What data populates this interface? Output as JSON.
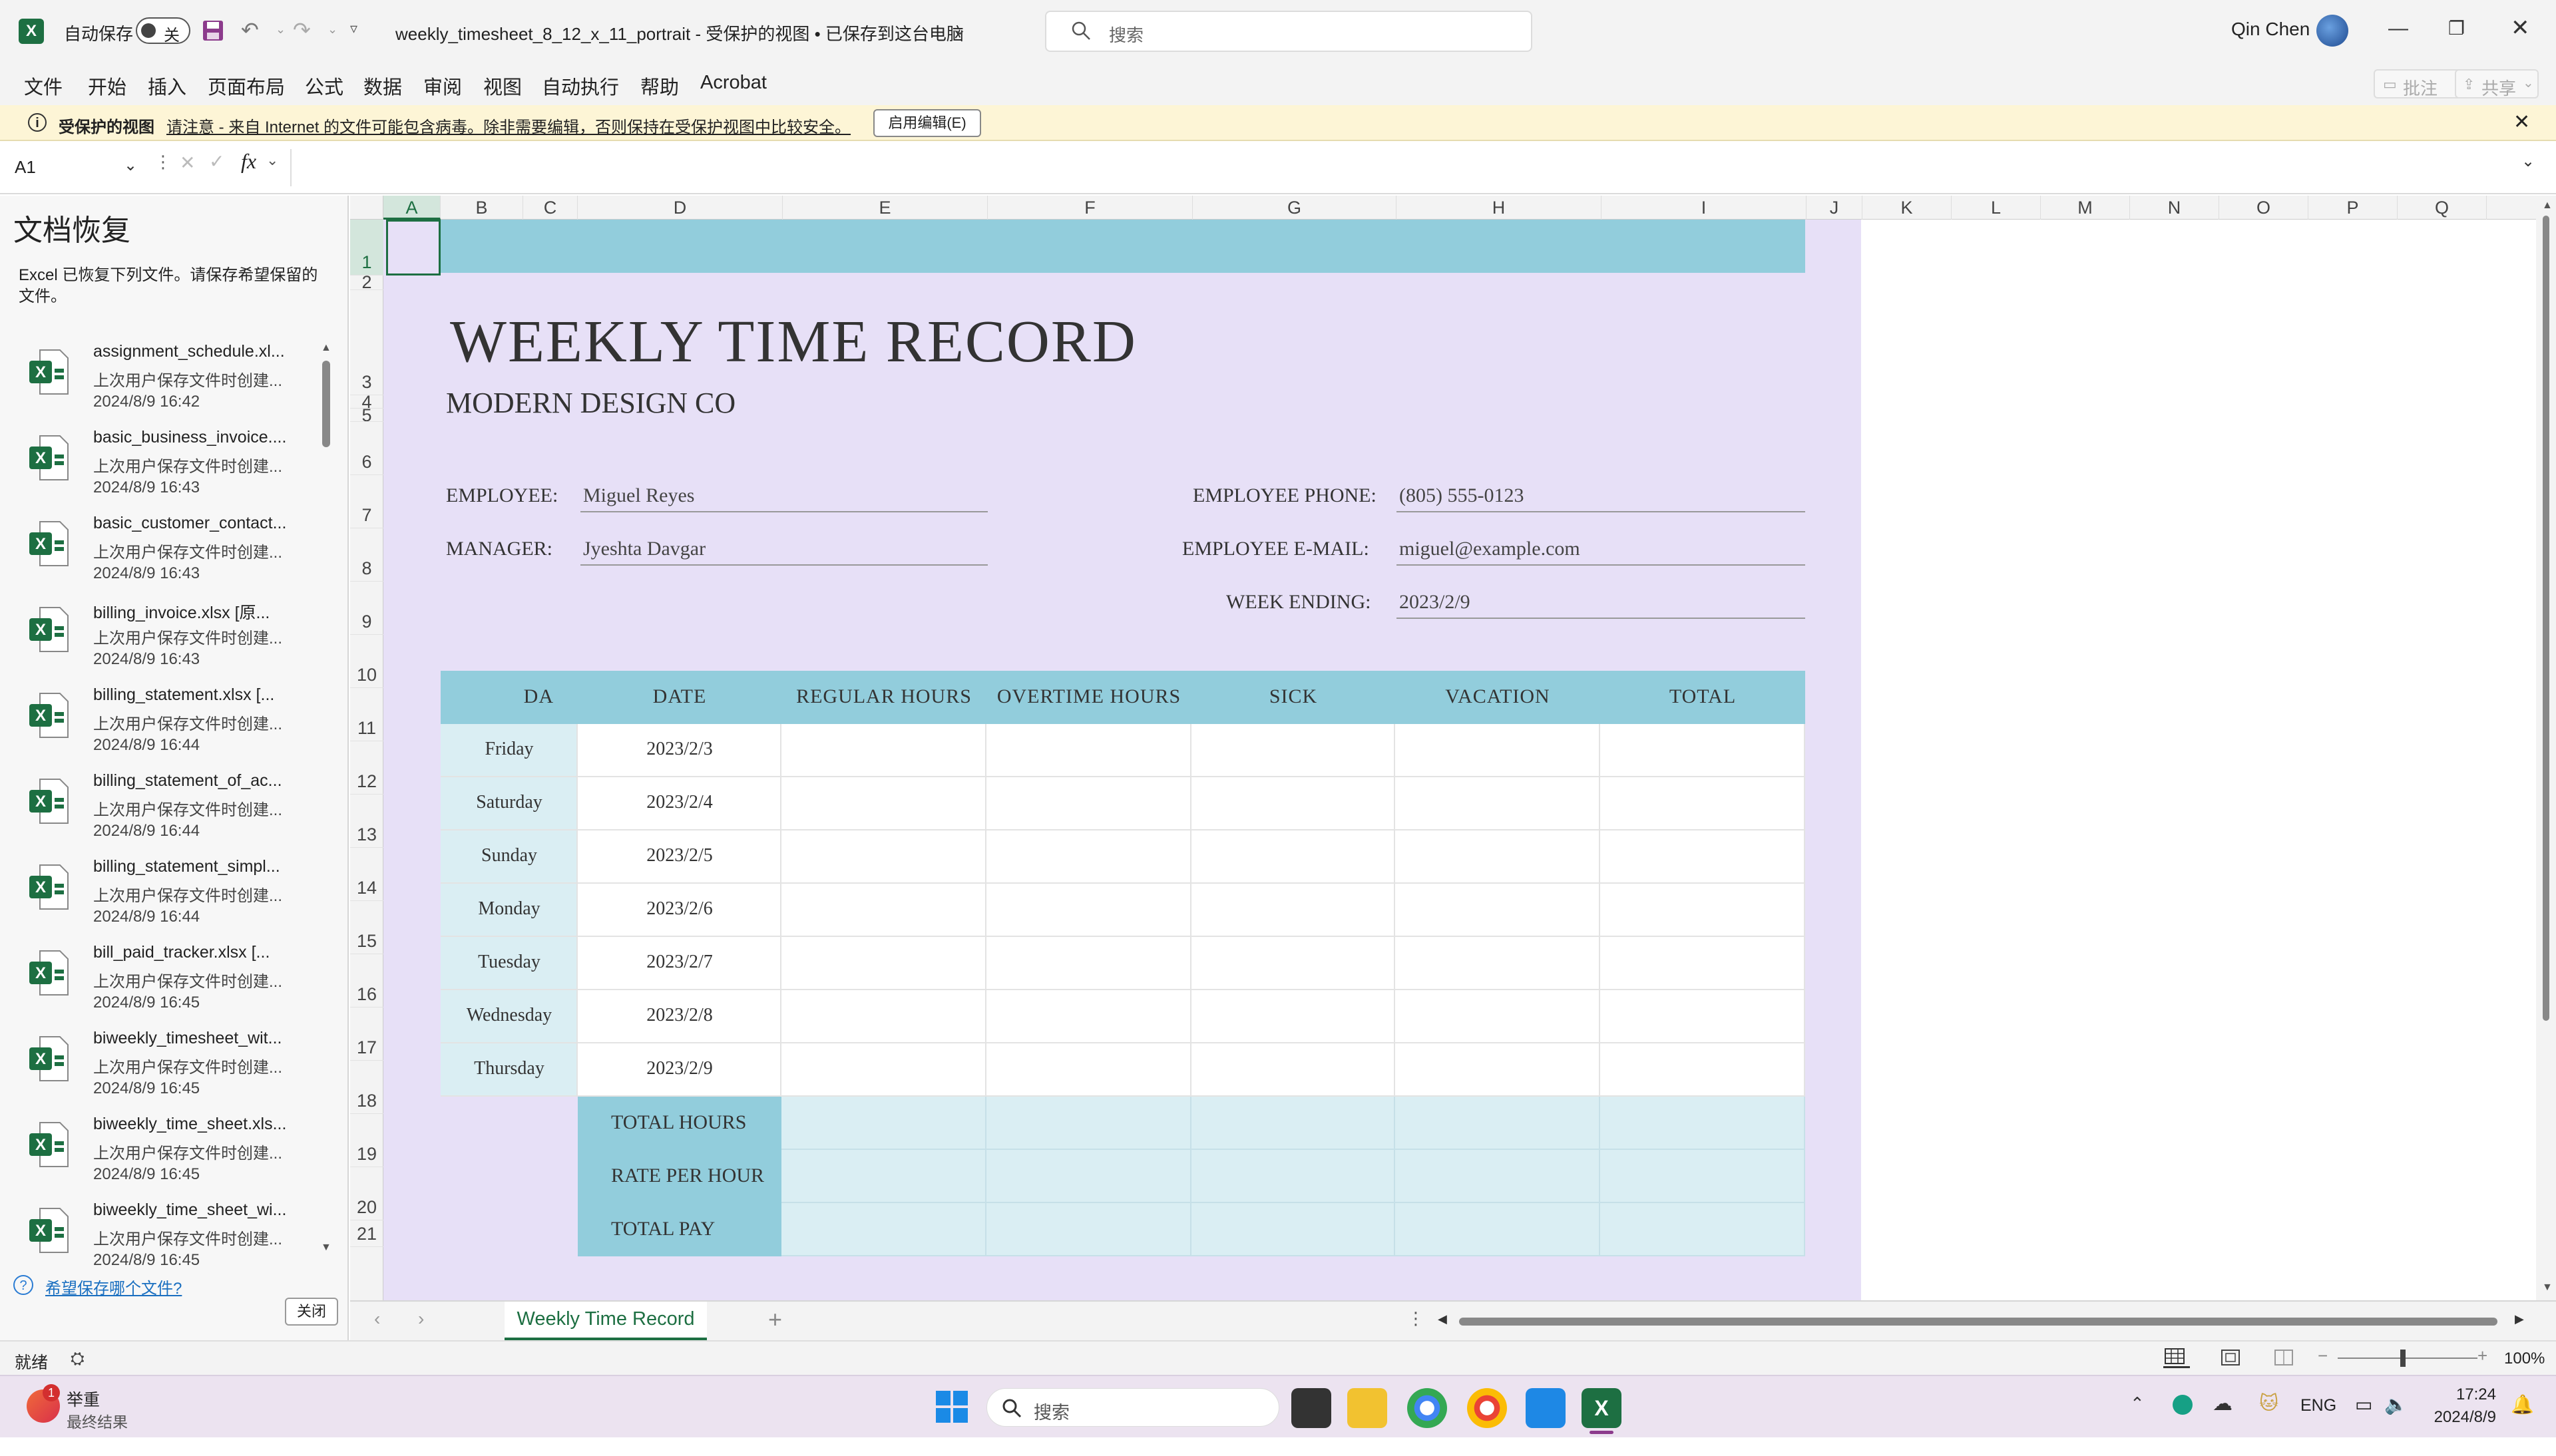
{
  "titlebar": {
    "autosave_label": "自动保存",
    "autosave_state": "关",
    "file_title": "weekly_timesheet_8_12_x_11_portrait  -  受保护的视图 • 已保存到这台电脑",
    "search_placeholder": "搜索",
    "user_name": "Qin Chen"
  },
  "menu": {
    "items": [
      "文件",
      "开始",
      "插入",
      "页面布局",
      "公式",
      "数据",
      "审阅",
      "视图",
      "自动执行",
      "帮助",
      "Acrobat"
    ],
    "comment_btn": "批注",
    "share_btn": "共享"
  },
  "protected": {
    "label": "受保护的视图",
    "message": "请注意 - 来自 Internet 的文件可能包含病毒。除非需要编辑，否则保持在受保护视图中比较安全。",
    "enable_btn": "启用编辑(E)"
  },
  "formula": {
    "name_box": "A1",
    "fx": "fx",
    "content": ""
  },
  "recovery": {
    "title": "文档恢复",
    "desc": "Excel 已恢复下列文件。请保存希望保留的文件。",
    "items": [
      {
        "name": "assignment_schedule.xl...",
        "sub": "上次用户保存文件时创建...",
        "time": "2024/8/9 16:42"
      },
      {
        "name": "basic_business_invoice....",
        "sub": "上次用户保存文件时创建...",
        "time": "2024/8/9 16:43"
      },
      {
        "name": "basic_customer_contact...",
        "sub": "上次用户保存文件时创建...",
        "time": "2024/8/9 16:43"
      },
      {
        "name": "billing_invoice.xlsx  [原...",
        "sub": "上次用户保存文件时创建...",
        "time": "2024/8/9 16:43"
      },
      {
        "name": "billing_statement.xlsx  [...",
        "sub": "上次用户保存文件时创建...",
        "time": "2024/8/9 16:44"
      },
      {
        "name": "billing_statement_of_ac...",
        "sub": "上次用户保存文件时创建...",
        "time": "2024/8/9 16:44"
      },
      {
        "name": "billing_statement_simpl...",
        "sub": "上次用户保存文件时创建...",
        "time": "2024/8/9 16:44"
      },
      {
        "name": "bill_paid_tracker.xlsx  [...",
        "sub": "上次用户保存文件时创建...",
        "time": "2024/8/9 16:45"
      },
      {
        "name": "biweekly_timesheet_wit...",
        "sub": "上次用户保存文件时创建...",
        "time": "2024/8/9 16:45"
      },
      {
        "name": "biweekly_time_sheet.xls...",
        "sub": "上次用户保存文件时创建...",
        "time": "2024/8/9 16:45"
      },
      {
        "name": "biweekly_time_sheet_wi...",
        "sub": "上次用户保存文件时创建...",
        "time": "2024/8/9 16:45"
      }
    ],
    "which_files_link": "希望保存哪个文件?",
    "close_btn": "关闭"
  },
  "columns": [
    "A",
    "B",
    "C",
    "D",
    "E",
    "F",
    "G",
    "H",
    "I",
    "J",
    "K",
    "L",
    "M",
    "N",
    "O",
    "P",
    "Q"
  ],
  "rows": [
    "1",
    "2",
    "3",
    "4",
    "5",
    "6",
    "7",
    "8",
    "9",
    "10",
    "11",
    "12",
    "13",
    "14",
    "15",
    "16",
    "17",
    "18",
    "19",
    "20",
    "21"
  ],
  "sheet": {
    "title": "WEEKLY TIME RECORD",
    "company": "MODERN DESIGN CO",
    "employee_label": "EMPLOYEE:",
    "employee": "Miguel Reyes",
    "manager_label": "MANAGER:",
    "manager": "Jyeshta Davgar",
    "phone_label": "EMPLOYEE PHONE:",
    "phone": "(805) 555-0123",
    "email_label": "EMPLOYEE E-MAIL:",
    "email": "miguel@example.com",
    "week_label": "WEEK ENDING:",
    "week": "2023/2/9",
    "headers": [
      "DA",
      "DATE",
      "REGULAR HOURS",
      "OVERTIME HOURS",
      "SICK",
      "VACATION",
      "TOTAL"
    ],
    "days": [
      {
        "day": "Friday",
        "date": "2023/2/3"
      },
      {
        "day": "Saturday",
        "date": "2023/2/4"
      },
      {
        "day": "Sunday",
        "date": "2023/2/5"
      },
      {
        "day": "Monday",
        "date": "2023/2/6"
      },
      {
        "day": "Tuesday",
        "date": "2023/2/7"
      },
      {
        "day": "Wednesday",
        "date": "2023/2/8"
      },
      {
        "day": "Thursday",
        "date": "2023/2/9"
      }
    ],
    "summary": [
      "TOTAL HOURS",
      "RATE PER HOUR",
      "TOTAL PAY"
    ]
  },
  "sheet_tab": "Weekly Time Record",
  "status": {
    "ready": "就绪",
    "zoom": "100%"
  },
  "taskbar": {
    "weather_title": "举重",
    "weather_sub": "最终结果",
    "search": "搜索",
    "lang": "ENG",
    "time": "17:24",
    "date": "2024/8/9",
    "badge": "1"
  },
  "colors": {
    "accent_blue": "#92cddc",
    "light_blue": "#daeef3",
    "lavender": "#e7e0f7",
    "excel_green": "#1d6f42"
  }
}
